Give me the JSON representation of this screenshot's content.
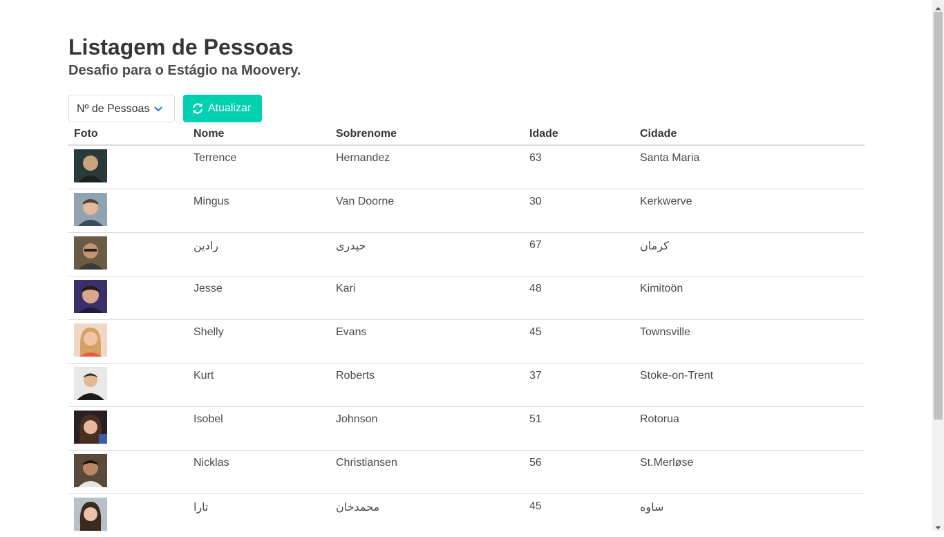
{
  "header": {
    "title": "Listagem de Pessoas",
    "subtitle": "Desafio para o Estágio na Moovery."
  },
  "controls": {
    "select_value": "Nº de Pessoas",
    "refresh_label": "Atualizar",
    "accent": "#00d1b2"
  },
  "table": {
    "columns": [
      "Foto",
      "Nome",
      "Sobrenome",
      "Idade",
      "Cidade"
    ],
    "rows": [
      {
        "nome": "Terrence",
        "sobrenome": "Hernandez",
        "idade": "63",
        "cidade": "Santa Maria"
      },
      {
        "nome": "Mingus",
        "sobrenome": "Van Doorne",
        "idade": "30",
        "cidade": "Kerkwerve"
      },
      {
        "nome": "رادین",
        "sobrenome": "حیدری",
        "idade": "67",
        "cidade": "کرمان"
      },
      {
        "nome": "Jesse",
        "sobrenome": "Kari",
        "idade": "48",
        "cidade": "Kimitoön"
      },
      {
        "nome": "Shelly",
        "sobrenome": "Evans",
        "idade": "45",
        "cidade": "Townsville"
      },
      {
        "nome": "Kurt",
        "sobrenome": "Roberts",
        "idade": "37",
        "cidade": "Stoke-on-Trent"
      },
      {
        "nome": "Isobel",
        "sobrenome": "Johnson",
        "idade": "51",
        "cidade": "Rotorua"
      },
      {
        "nome": "Nicklas",
        "sobrenome": "Christiansen",
        "idade": "56",
        "cidade": "St.Merløse"
      },
      {
        "nome": "تارا",
        "sobrenome": "محمدخان",
        "idade": "45",
        "cidade": "ساوه"
      }
    ]
  }
}
